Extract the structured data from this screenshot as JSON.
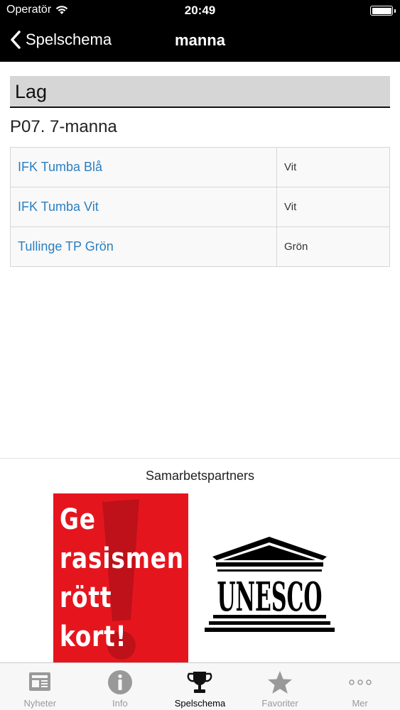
{
  "status_bar": {
    "carrier": "Operatör",
    "time": "20:49"
  },
  "nav": {
    "back_label": "Spelschema",
    "title": "manna"
  },
  "section": {
    "header": "Lag",
    "group_title": "P07. 7-manna"
  },
  "teams": [
    {
      "name": "IFK Tumba Blå",
      "color": "Vit"
    },
    {
      "name": "IFK Tumba Vit",
      "color": "Vit"
    },
    {
      "name": "Tullinge TP Grön",
      "color": "Grön"
    }
  ],
  "partners": {
    "title": "Samarbetspartners",
    "logos": [
      {
        "name": "ge-rasismen-rott-kort-logo",
        "text_lines": [
          "Ge",
          "rasismen",
          "rött",
          "kort!"
        ]
      },
      {
        "name": "unesco-logo",
        "text": "UNESCO"
      }
    ]
  },
  "tab_bar": {
    "tabs": [
      {
        "label": "Nyheter",
        "icon": "newspaper-icon",
        "active": false
      },
      {
        "label": "Info",
        "icon": "info-icon",
        "active": false
      },
      {
        "label": "Spelschema",
        "icon": "trophy-icon",
        "active": true
      },
      {
        "label": "Favoriter",
        "icon": "star-icon",
        "active": false
      },
      {
        "label": "Mer",
        "icon": "more-icon",
        "active": false
      }
    ]
  },
  "colors": {
    "link": "#2a7fc1",
    "bar_background": "#000000",
    "tab_inactive": "#999999",
    "tab_active": "#000000",
    "partner_red": "#e5151e"
  }
}
